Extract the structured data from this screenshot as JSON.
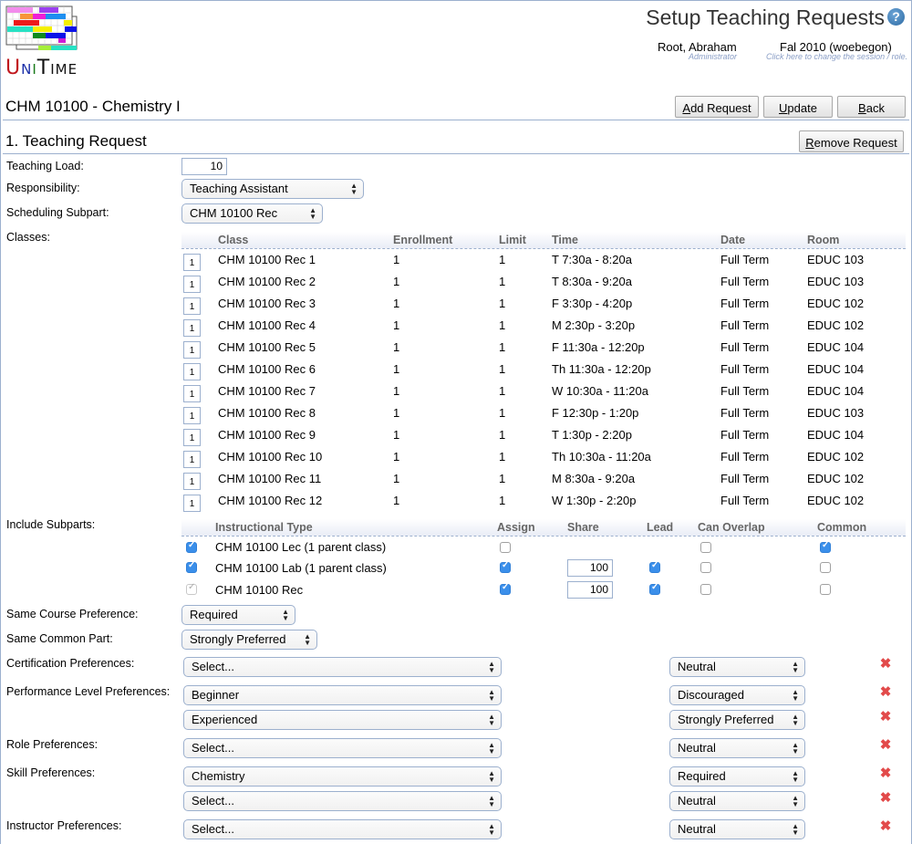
{
  "app": {
    "logo_text": {
      "u": "U",
      "n": "N",
      "i": "I",
      "t": "T",
      "ime": "IME"
    },
    "page_title": "Setup Teaching Requests",
    "help_icon": "question-circle-icon"
  },
  "user": {
    "name": "Root, Abraham",
    "role": "Administrator"
  },
  "session": {
    "name": "Fal 2010 (woebegon)",
    "hint": "Click here to change the session / role."
  },
  "course": {
    "title": "CHM 10100 - Chemistry I"
  },
  "toolbar": {
    "add_request": {
      "accel": "A",
      "rest": "dd Request"
    },
    "update": {
      "accel": "U",
      "rest": "pdate"
    },
    "back": {
      "accel": "B",
      "rest": "ack"
    }
  },
  "request": {
    "title": "1. Teaching Request",
    "remove": {
      "accel": "R",
      "rest": "emove Request"
    },
    "labels": {
      "teaching_load": "Teaching Load:",
      "responsibility": "Responsibility:",
      "scheduling_subpart": "Scheduling Subpart:",
      "classes": "Classes:",
      "include_subparts": "Include Subparts:",
      "same_course": "Same Course Preference:",
      "same_common": "Same Common Part:",
      "certification": "Certification Preferences:",
      "performance": "Performance Level Preferences:",
      "role": "Role Preferences:",
      "skill": "Skill Preferences:",
      "instructor": "Instructor Preferences:"
    },
    "teaching_load": "10",
    "responsibility": "Teaching Assistant",
    "scheduling_subpart": "CHM 10100 Rec",
    "classes": {
      "headers": [
        "Class",
        "Enrollment",
        "Limit",
        "Time",
        "Date",
        "Room"
      ],
      "rows": [
        {
          "count": "1",
          "class": "CHM 10100 Rec 1",
          "enrollment": "1",
          "limit": "1",
          "time": "T 7:30a - 8:20a",
          "date": "Full Term",
          "room": "EDUC 103"
        },
        {
          "count": "1",
          "class": "CHM 10100 Rec 2",
          "enrollment": "1",
          "limit": "1",
          "time": "T 8:30a - 9:20a",
          "date": "Full Term",
          "room": "EDUC 103"
        },
        {
          "count": "1",
          "class": "CHM 10100 Rec 3",
          "enrollment": "1",
          "limit": "1",
          "time": "F 3:30p - 4:20p",
          "date": "Full Term",
          "room": "EDUC 102"
        },
        {
          "count": "1",
          "class": "CHM 10100 Rec 4",
          "enrollment": "1",
          "limit": "1",
          "time": "M 2:30p - 3:20p",
          "date": "Full Term",
          "room": "EDUC 102"
        },
        {
          "count": "1",
          "class": "CHM 10100 Rec 5",
          "enrollment": "1",
          "limit": "1",
          "time": "F 11:30a - 12:20p",
          "date": "Full Term",
          "room": "EDUC 104"
        },
        {
          "count": "1",
          "class": "CHM 10100 Rec 6",
          "enrollment": "1",
          "limit": "1",
          "time": "Th 11:30a - 12:20p",
          "date": "Full Term",
          "room": "EDUC 104"
        },
        {
          "count": "1",
          "class": "CHM 10100 Rec 7",
          "enrollment": "1",
          "limit": "1",
          "time": "W 10:30a - 11:20a",
          "date": "Full Term",
          "room": "EDUC 104"
        },
        {
          "count": "1",
          "class": "CHM 10100 Rec 8",
          "enrollment": "1",
          "limit": "1",
          "time": "F 12:30p - 1:20p",
          "date": "Full Term",
          "room": "EDUC 103"
        },
        {
          "count": "1",
          "class": "CHM 10100 Rec 9",
          "enrollment": "1",
          "limit": "1",
          "time": "T 1:30p - 2:20p",
          "date": "Full Term",
          "room": "EDUC 104"
        },
        {
          "count": "1",
          "class": "CHM 10100 Rec 10",
          "enrollment": "1",
          "limit": "1",
          "time": "Th 10:30a - 11:20a",
          "date": "Full Term",
          "room": "EDUC 102"
        },
        {
          "count": "1",
          "class": "CHM 10100 Rec 11",
          "enrollment": "1",
          "limit": "1",
          "time": "M 8:30a - 9:20a",
          "date": "Full Term",
          "room": "EDUC 102"
        },
        {
          "count": "1",
          "class": "CHM 10100 Rec 12",
          "enrollment": "1",
          "limit": "1",
          "time": "W 1:30p - 2:20p",
          "date": "Full Term",
          "room": "EDUC 102"
        }
      ]
    },
    "subparts": {
      "headers": [
        "Instructional Type",
        "Assign",
        "Share",
        "Lead",
        "Can Overlap",
        "Common"
      ],
      "rows": [
        {
          "include": "checked",
          "type": "CHM 10100 Lec (1 parent class)",
          "assign": false,
          "share": null,
          "lead": null,
          "overlap": false,
          "common": true
        },
        {
          "include": "checked",
          "type": "CHM 10100 Lab (1 parent class)",
          "assign": true,
          "share": "100",
          "lead": true,
          "overlap": false,
          "common": false
        },
        {
          "include": "disabled",
          "type": "CHM 10100 Rec",
          "assign": true,
          "share": "100",
          "lead": true,
          "overlap": false,
          "common": false
        }
      ]
    },
    "same_course": "Required",
    "same_common": "Strongly Preferred",
    "preferences": [
      {
        "group": "certification",
        "value": "Select...",
        "level": "Neutral"
      },
      {
        "group": "performance",
        "value": "Beginner",
        "level": "Discouraged"
      },
      {
        "group": "performance",
        "value": "Experienced",
        "level": "Strongly Preferred"
      },
      {
        "group": "role",
        "value": "Select...",
        "level": "Neutral"
      },
      {
        "group": "skill",
        "value": "Chemistry",
        "level": "Required"
      },
      {
        "group": "skill",
        "value": "Select...",
        "level": "Neutral"
      },
      {
        "group": "instructor",
        "value": "Select...",
        "level": "Neutral"
      }
    ]
  },
  "colors": {
    "accent_border": "#9cb0ce",
    "checkbox_on": "#3b8fea",
    "delete_icon": "#e24a4a",
    "hint_text": "#8a9ec6"
  }
}
